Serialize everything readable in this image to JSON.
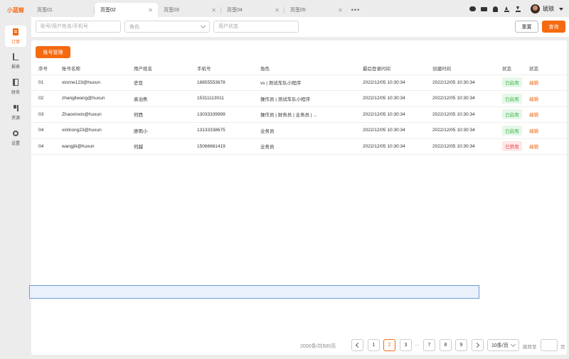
{
  "app": {
    "logo": "小蓝鲸"
  },
  "sidebar": {
    "items": [
      {
        "label": "订单",
        "icon": "order-icon"
      },
      {
        "label": "报表",
        "icon": "report-icon"
      },
      {
        "label": "财务",
        "icon": "finance-icon"
      },
      {
        "label": "资源",
        "icon": "resource-icon"
      },
      {
        "label": "设置",
        "icon": "settings-icon"
      }
    ]
  },
  "tabs": [
    {
      "label": "页签01",
      "active": false
    },
    {
      "label": "页签02",
      "active": true
    },
    {
      "label": "页签03",
      "active": false
    },
    {
      "label": "页签04",
      "active": false
    },
    {
      "label": "页签05",
      "active": false
    }
  ],
  "tab_more": "•••",
  "topbar": {
    "icons": [
      "wechat-icon",
      "truck-icon",
      "bell-icon",
      "upload-icon",
      "download-icon"
    ],
    "user_name": "琥琅"
  },
  "filters": {
    "search_placeholder": "账号/用户姓名/手机号",
    "role_placeholder": "角色",
    "status_placeholder": "用户状态",
    "reset_label": "重置",
    "query_label": "查询"
  },
  "main": {
    "account_button": "账号管理",
    "columns": [
      "序号",
      "账号名称",
      "用户姓名",
      "手机号",
      "角色",
      "最后登录时间",
      "创建时间",
      "状态",
      "状态"
    ],
    "rows": [
      {
        "no": "01",
        "account": "xinzne123@huxun",
        "name": "史亚",
        "phone": "18855553678",
        "role": "vs | 测试车队小程序",
        "last_login": "2022/12/05 10:30:34",
        "created": "2022/12/05 10:30:34",
        "status": "已启用",
        "action": "编辑"
      },
      {
        "no": "02",
        "account": "zhangliwang@huxun",
        "name": "袁泊焦",
        "phone": "15311113011",
        "role": "操作员 | 测试车队小程序",
        "last_login": "2022/12/05 10:30:34",
        "created": "2022/12/05 10:30:34",
        "status": "已启用",
        "action": "编辑"
      },
      {
        "no": "03",
        "account": "Zhaoxinxin@huxun",
        "name": "何西",
        "phone": "13033339999",
        "role": "操作员 | 财务员 | 业务员 | ...",
        "last_login": "2022/12/05 10:30:34",
        "created": "2022/12/05 10:30:34",
        "status": "已启用",
        "action": "编辑"
      },
      {
        "no": "04",
        "account": "xinlirong23@huxun",
        "name": "廖雨小",
        "phone": "13133338675",
        "role": "业务员",
        "last_login": "2022/12/05 10:30:34",
        "created": "2022/12/05 10:30:34",
        "status": "已启用",
        "action": "编辑"
      },
      {
        "no": "04",
        "account": "wangjili@huxun",
        "name": "何越",
        "phone": "15066661419",
        "role": "业务员",
        "last_login": "2022/12/05 10:30:34",
        "created": "2022/12/05 10:30:34",
        "status": "已禁用",
        "action": "编辑"
      }
    ]
  },
  "pagination": {
    "total": "2000条/共500页",
    "pages_before": [
      "1",
      "2",
      "3"
    ],
    "ellipsis": "...",
    "pages_after": [
      "7",
      "8",
      "9"
    ],
    "current": "2",
    "page_size": "10条/页",
    "jump_label": "跳转至",
    "jump_suffix": "页"
  },
  "colors": {
    "accent": "#f56a10",
    "enabled": "#3bb54a",
    "disabled": "#e5484d"
  }
}
